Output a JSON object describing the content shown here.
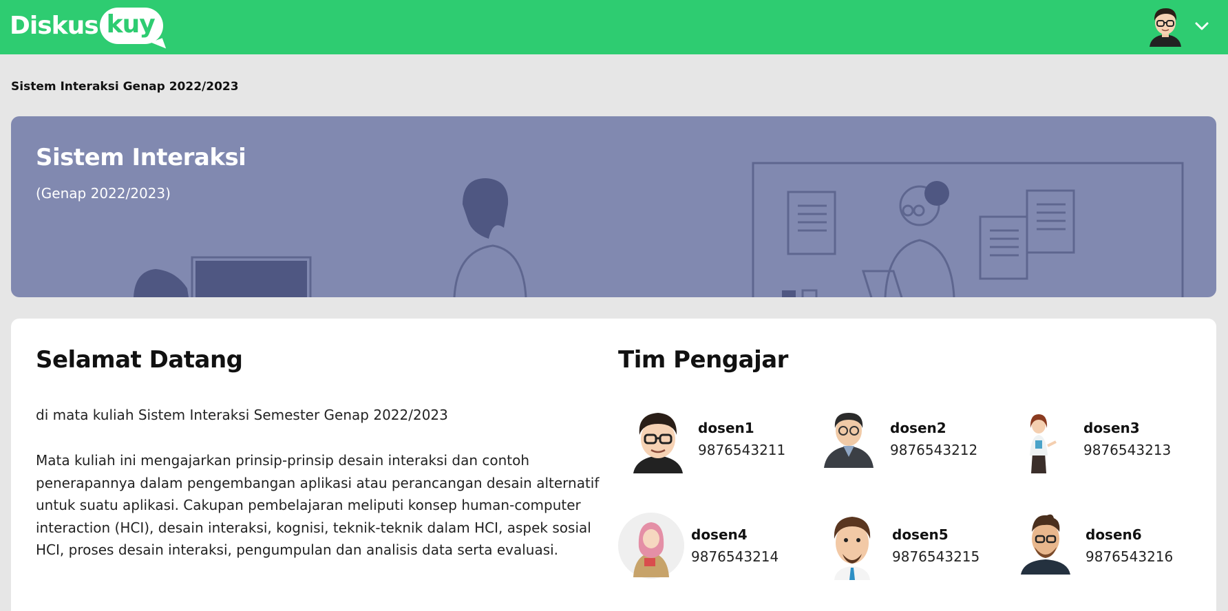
{
  "header": {
    "logo_main": "Diskus",
    "logo_bubble": "kuy"
  },
  "breadcrumb": "Sistem Interaksi Genap 2022/2023",
  "banner": {
    "title": "Sistem Interaksi",
    "subtitle": "(Genap 2022/2023)"
  },
  "welcome": {
    "title": "Selamat Datang",
    "intro": "di mata kuliah Sistem Interaksi Semester Genap 2022/2023",
    "description": "Mata kuliah ini mengajarkan prinsip-prinsip desain interaksi dan contoh penerapannya dalam pengembangan aplikasi atau perancangan desain alternatif untuk suatu aplikasi. Cakupan pembelajaran meliputi konsep human-computer interaction (HCI), desain interaksi, kognisi, teknik-teknik dalam HCI, aspek sosial HCI, proses desain interaksi, pengumpulan dan analisis data serta evaluasi."
  },
  "team": {
    "title": "Tim Pengajar",
    "lecturers": [
      {
        "name": "dosen1",
        "phone": "9876543211"
      },
      {
        "name": "dosen2",
        "phone": "9876543212"
      },
      {
        "name": "dosen3",
        "phone": "9876543213"
      },
      {
        "name": "dosen4",
        "phone": "9876543214"
      },
      {
        "name": "dosen5",
        "phone": "9876543215"
      },
      {
        "name": "dosen6",
        "phone": "9876543216"
      }
    ]
  },
  "colors": {
    "header_green": "#2ecc71",
    "banner_blue": "#8189b0",
    "page_background": "#e6e6e6"
  },
  "icons": {
    "user_menu": "user-avatar",
    "dropdown": "chevron-down-icon"
  }
}
